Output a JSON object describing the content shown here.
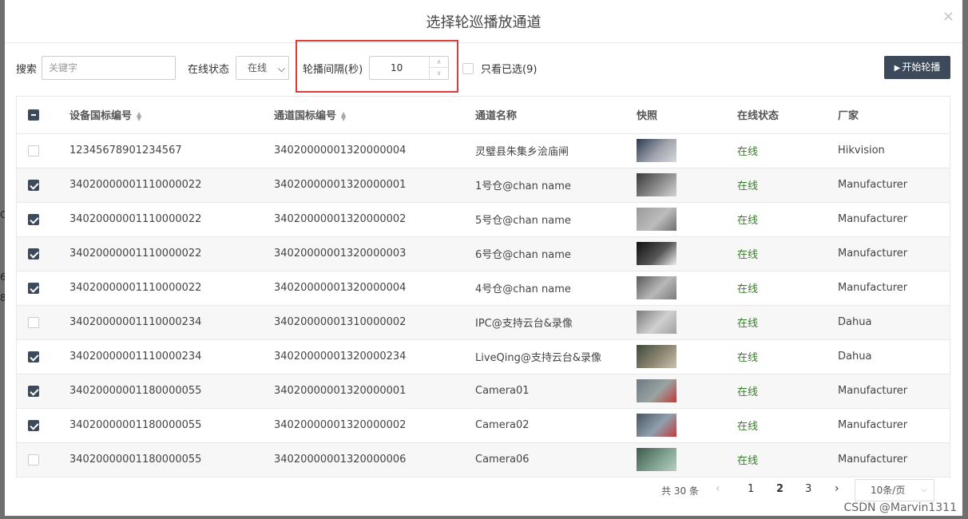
{
  "background_fragments": [
    "C",
    "6",
    "8"
  ],
  "dialog": {
    "title": "选择轮巡播放通道",
    "close_icon": "×"
  },
  "toolbar": {
    "search_label": "搜索",
    "search_placeholder": "关键字",
    "status_label": "在线状态",
    "status_value": "在线",
    "interval_label": "轮播间隔(秒)",
    "interval_value": "10",
    "only_selected_label": "只看已选(9)",
    "only_selected_checked": false,
    "start_button_label": "开始轮播",
    "start_button_icon": "play-icon"
  },
  "table": {
    "columns": [
      "设备国标编号",
      "通道国标编号",
      "通道名称",
      "快照",
      "在线状态",
      "厂家"
    ],
    "rows": [
      {
        "checked": false,
        "device_id": "12345678901234567",
        "channel_id": "34020000001320000004",
        "name": "灵璧县朱集乡浍庙闸",
        "status": "在线",
        "vendor": "Hikvision",
        "snap": [
          "#2b3a52",
          "#a2a4ad",
          "#d6d8de"
        ]
      },
      {
        "checked": true,
        "device_id": "34020000001110000022",
        "channel_id": "34020000001320000001",
        "name": "1号仓@chan name",
        "status": "在线",
        "vendor": "Manufacturer",
        "snap": [
          "#3a3a3a",
          "#8d8d8d",
          "#d3d3d3"
        ]
      },
      {
        "checked": true,
        "device_id": "34020000001110000022",
        "channel_id": "34020000001320000002",
        "name": "5号仓@chan name",
        "status": "在线",
        "vendor": "Manufacturer",
        "snap": [
          "#9a9a9a",
          "#bcbcbc",
          "#707070"
        ]
      },
      {
        "checked": true,
        "device_id": "34020000001110000022",
        "channel_id": "34020000001320000003",
        "name": "6号仓@chan name",
        "status": "在线",
        "vendor": "Manufacturer",
        "snap": [
          "#111111",
          "#555555",
          "#eeeeee"
        ]
      },
      {
        "checked": true,
        "device_id": "34020000001110000022",
        "channel_id": "34020000001320000004",
        "name": "4号仓@chan name",
        "status": "在线",
        "vendor": "Manufacturer",
        "snap": [
          "#5a5a5a",
          "#b8b8b8",
          "#7a7a7a"
        ]
      },
      {
        "checked": false,
        "device_id": "34020000001110000234",
        "channel_id": "34020000001310000002",
        "name": "IPC@支持云台&录像",
        "status": "在线",
        "vendor": "Dahua",
        "snap": [
          "#7b7b7b",
          "#d0d0d0",
          "#a0a0a0"
        ]
      },
      {
        "checked": true,
        "device_id": "34020000001110000234",
        "channel_id": "34020000001320000234",
        "name": "LiveQing@支持云台&录像",
        "status": "在线",
        "vendor": "Dahua",
        "snap": [
          "#3f4a3a",
          "#8d8673",
          "#c9c3b0"
        ]
      },
      {
        "checked": true,
        "device_id": "34020000001180000055",
        "channel_id": "34020000001320000001",
        "name": "Camera01",
        "status": "在线",
        "vendor": "Manufacturer",
        "snap": [
          "#6b7a84",
          "#9aa3a0",
          "#c03a3a"
        ]
      },
      {
        "checked": true,
        "device_id": "34020000001180000055",
        "channel_id": "34020000001320000002",
        "name": "Camera02",
        "status": "在线",
        "vendor": "Manufacturer",
        "snap": [
          "#4a5560",
          "#8fa0ae",
          "#c23b3b"
        ]
      },
      {
        "checked": false,
        "device_id": "34020000001180000055",
        "channel_id": "34020000001320000006",
        "name": "Camera06",
        "status": "在线",
        "vendor": "Manufacturer",
        "snap": [
          "#3e5a4a",
          "#7fa08e",
          "#b9cfc2"
        ]
      }
    ]
  },
  "pagination": {
    "total": "共 30 条",
    "pages": [
      "1",
      "2",
      "3"
    ],
    "current": "2",
    "page_size": "10条/页"
  },
  "watermark": "CSDN @Marvin1311",
  "colors": {
    "primary": "#3c4a5b",
    "online": "#3a7a2e",
    "highlight": "#e03b3b"
  }
}
